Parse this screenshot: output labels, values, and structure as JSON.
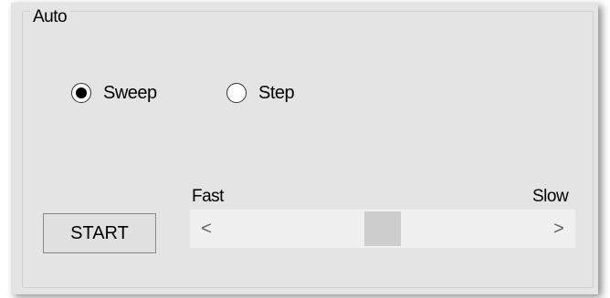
{
  "group": {
    "title": "Auto"
  },
  "mode": {
    "options": [
      {
        "label": "Sweep",
        "selected": true
      },
      {
        "label": "Step",
        "selected": false
      }
    ]
  },
  "speed": {
    "min_label": "Fast",
    "max_label": "Slow",
    "left_arrow": "<",
    "right_arrow": ">",
    "value_fraction": 0.5
  },
  "start_button": {
    "label": "START"
  },
  "icons": {
    "left_arrow": "chevron-left-icon",
    "right_arrow": "chevron-right-icon"
  }
}
